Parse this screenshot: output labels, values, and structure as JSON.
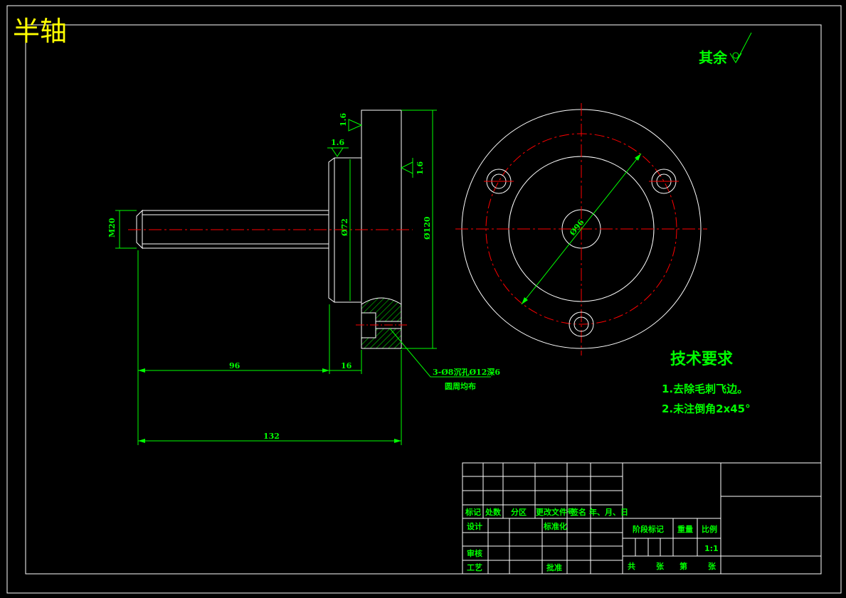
{
  "title": "半轴",
  "surface_note": "其余",
  "dimensions": {
    "thread": "M20",
    "dia_72": "Ø72",
    "dia_120": "Ø120",
    "dia_96": "Ø96",
    "len_96": "96",
    "len_16": "16",
    "len_132": "132",
    "rough_1": "1.6",
    "rough_2": "1.6",
    "rough_3": "1.6",
    "hole_note_1": "3-Ø8沉孔Ø12深6",
    "hole_note_2": "圆周均布"
  },
  "requirements": {
    "title": "技术要求",
    "item1": "1.去除毛刺飞边。",
    "item2": "2.未注倒角2x45°"
  },
  "title_block": {
    "biaoji": "标记",
    "chushu": "处数",
    "fenqu": "分区",
    "genggai": "更改文件号",
    "qianming": "签名",
    "nianyueri": "年、月、日",
    "sheji": "设计",
    "biaozhunhua": "标准化",
    "shenhe": "审核",
    "gongyi": "工艺",
    "pizhun": "批准",
    "jieduan": "阶段标记",
    "zhongliang": "重量",
    "bili": "比例",
    "scale": "1:1",
    "gong": "共",
    "zhang1": "张",
    "di": "第",
    "zhang2": "张"
  },
  "colors": {
    "outline": "#ffffff",
    "dimension": "#00ff00",
    "centerline": "#ff0000",
    "title": "#ffff00",
    "background": "#000000"
  }
}
